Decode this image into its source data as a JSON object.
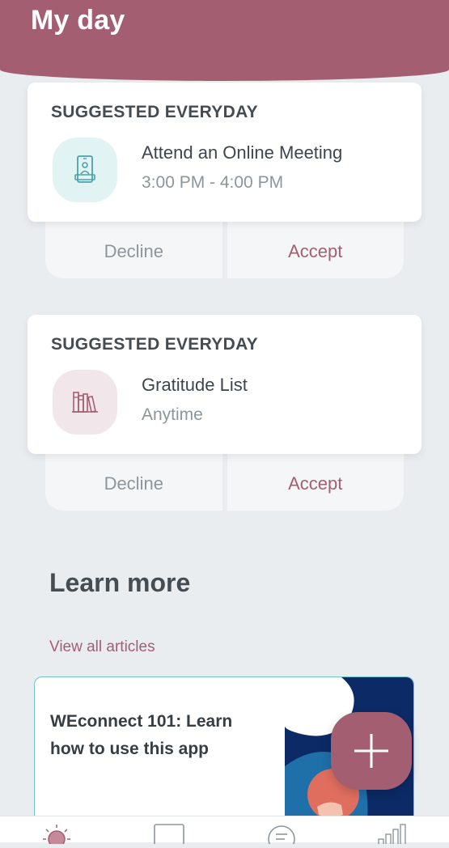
{
  "header": {
    "title": "My day"
  },
  "suggestions": [
    {
      "category": "SUGGESTED EVERYDAY",
      "name": "Attend an Online Meeting",
      "time": "3:00 PM - 4:00 PM",
      "icon": "video-call-icon",
      "decline_label": "Decline",
      "accept_label": "Accept"
    },
    {
      "category": "SUGGESTED EVERYDAY",
      "name": "Gratitude List",
      "time": "Anytime",
      "icon": "books-icon",
      "decline_label": "Decline",
      "accept_label": "Accept"
    }
  ],
  "learn_more": {
    "title": "Learn more",
    "view_all_label": "View all articles",
    "articles": [
      {
        "title": "WEconnect 101: Learn how to use this app"
      }
    ]
  },
  "fab": {
    "icon": "plus-icon"
  },
  "tabbar": {
    "icons": [
      "sun-icon",
      "laptop-icon",
      "chat-icon",
      "bar-chart-icon"
    ]
  },
  "colors": {
    "brand": "#a45e72",
    "teal_accent": "#6fc4cc",
    "background": "#e9edf0"
  }
}
